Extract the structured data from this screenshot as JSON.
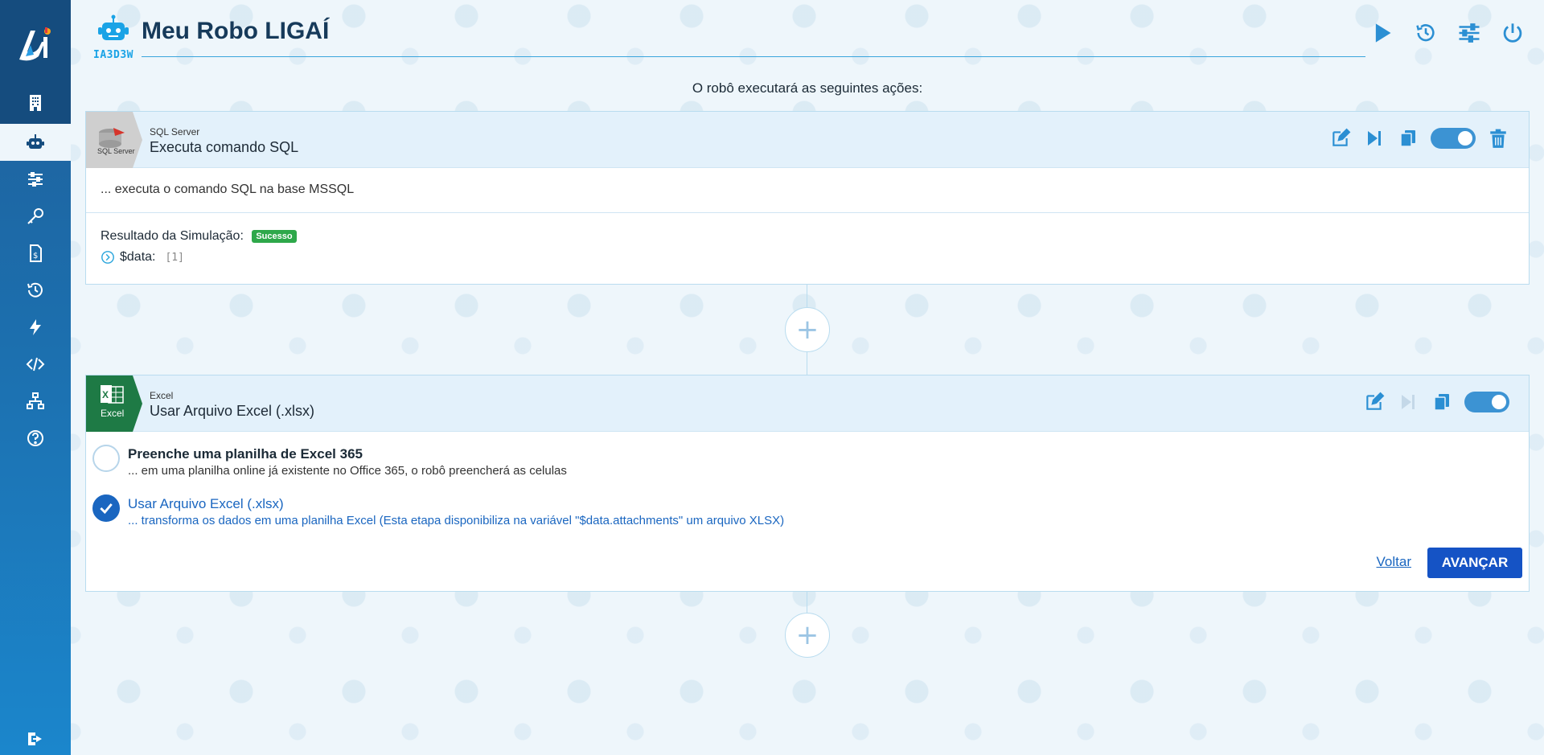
{
  "app": {
    "title": "Meu Robo LIGAÍ",
    "robot_code": "IA3D3W",
    "subtitle": "O robô executará as seguintes ações:"
  },
  "sidebar": {
    "items": [
      {
        "icon": "building-icon"
      },
      {
        "icon": "robot-icon",
        "active": true
      },
      {
        "icon": "sliders-icon"
      },
      {
        "icon": "key-icon"
      },
      {
        "icon": "invoice-icon"
      },
      {
        "icon": "history-icon"
      },
      {
        "icon": "bolt-icon"
      },
      {
        "icon": "code-icon"
      },
      {
        "icon": "sitemap-icon"
      },
      {
        "icon": "help-icon"
      },
      {
        "icon": "logout-icon"
      }
    ]
  },
  "header_actions": [
    "play-icon",
    "history-icon",
    "sliders-icon",
    "power-icon"
  ],
  "steps": [
    {
      "category": "SQL Server",
      "title": "Executa comando SQL",
      "tag_label": "SQL Server",
      "description": "... executa o comando SQL na base MSSQL",
      "simulation_label": "Resultado da Simulação:",
      "simulation_status": "Sucesso",
      "data_key": "$data:",
      "data_value": "[1]",
      "enabled": true
    },
    {
      "category": "Excel",
      "title": "Usar Arquivo Excel (.xlsx)",
      "tag_label": "Excel",
      "enabled": true,
      "options": [
        {
          "title": "Preenche uma planilha de Excel 365",
          "subtitle": "... em uma planilha online já existente no Office 365, o robô preencherá as celulas",
          "selected": false
        },
        {
          "title": "Usar Arquivo Excel (.xlsx)",
          "subtitle": "... transforma os dados em uma planilha Excel (Esta etapa disponibiliza na variável \"$data.attachments\" um arquivo XLSX)",
          "selected": true
        }
      ],
      "back_label": "Voltar",
      "next_label": "AVANÇAR"
    }
  ],
  "colors": {
    "sidebar": "#1c6fae",
    "accent": "#1a66c0",
    "success": "#2ea84a",
    "primary_button": "#1553c5"
  }
}
